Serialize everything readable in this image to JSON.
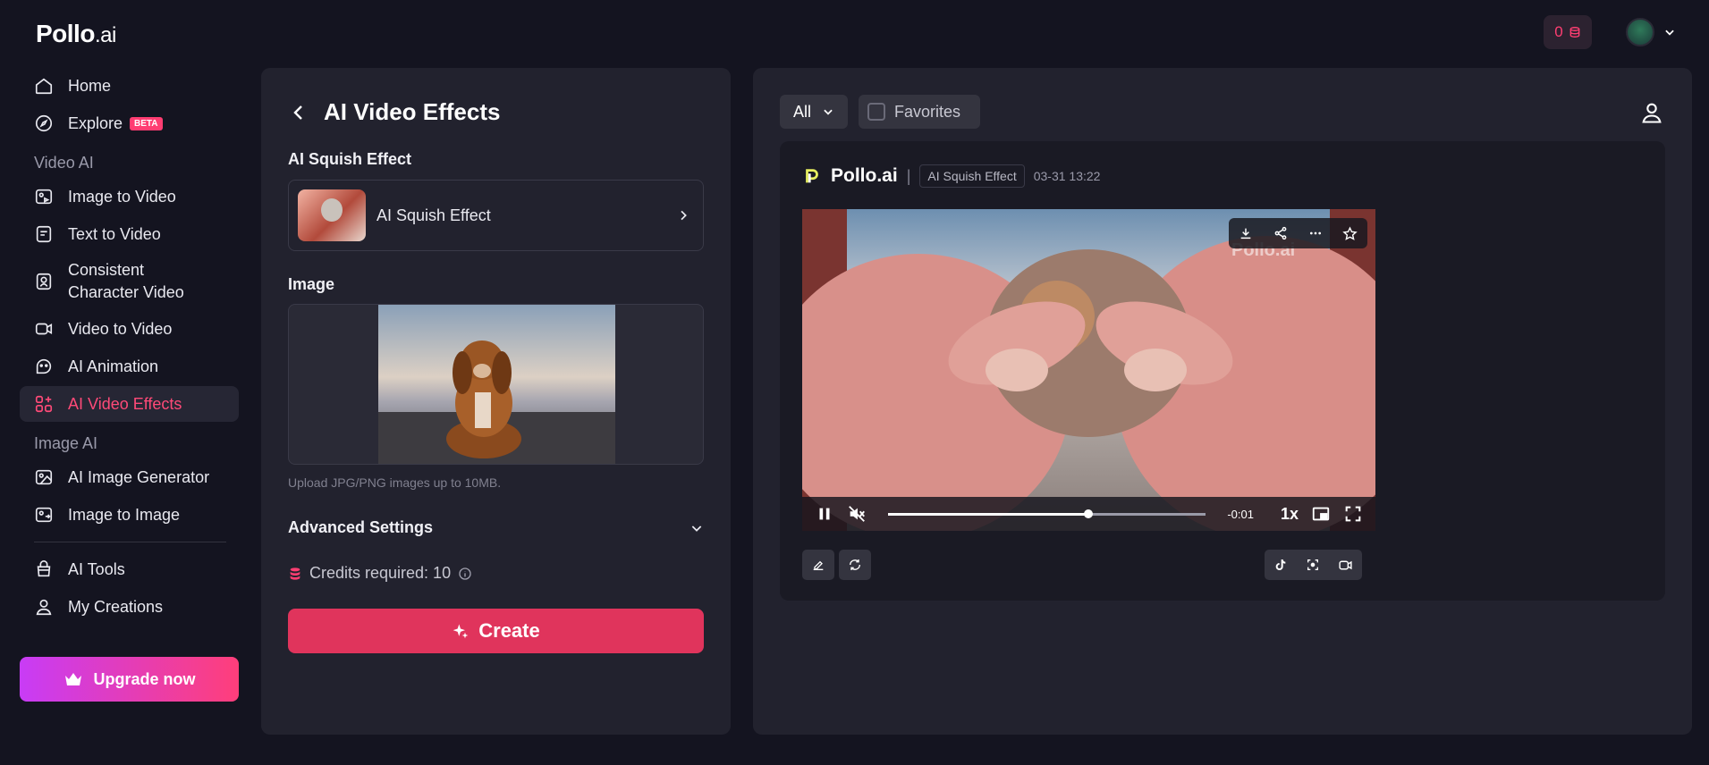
{
  "logo": {
    "main": "Pollo",
    "suffix": ".ai"
  },
  "sidebar": {
    "items": [
      {
        "label": "Home",
        "icon": "home-icon"
      },
      {
        "label": "Explore",
        "icon": "compass-icon",
        "badge": "BETA"
      }
    ],
    "section_video": "Video AI",
    "video_items": [
      {
        "label": "Image to Video",
        "icon": "image-video-icon"
      },
      {
        "label": "Text to Video",
        "icon": "text-video-icon"
      },
      {
        "label": "Consistent Character Video",
        "icon": "character-icon"
      },
      {
        "label": "Video to Video",
        "icon": "video-icon"
      },
      {
        "label": "AI Animation",
        "icon": "animation-icon"
      },
      {
        "label": "AI Video Effects",
        "icon": "effects-icon",
        "active": true
      }
    ],
    "section_image": "Image AI",
    "image_items": [
      {
        "label": "AI Image Generator",
        "icon": "image-gen-icon"
      },
      {
        "label": "Image to Image",
        "icon": "image-image-icon"
      }
    ],
    "bottom_items": [
      {
        "label": "AI Tools",
        "icon": "tools-icon"
      },
      {
        "label": "My Creations",
        "icon": "user-icon"
      }
    ],
    "upgrade_label": "Upgrade now"
  },
  "topbar": {
    "credits": "0"
  },
  "form": {
    "title": "AI Video Effects",
    "effect_label": "AI Squish Effect",
    "effect_selected": "AI Squish Effect",
    "image_label": "Image",
    "upload_hint": "Upload JPG/PNG images up to 10MB.",
    "advanced_label": "Advanced Settings",
    "credits_required": "Credits required: 10",
    "create_label": "Create"
  },
  "results": {
    "filter_value": "All",
    "favorites_label": "Favorites",
    "card": {
      "brand": "Pollo.ai",
      "tag": "AI Squish Effect",
      "timestamp": "03-31 13:22",
      "watermark": "Pollo.ai",
      "time_remaining": "-0:01",
      "speed": "1x",
      "progress": 0.63
    }
  },
  "colors": {
    "accent": "#ff3e72",
    "create": "#e0345c",
    "panel": "#22222e",
    "bg": "#141420"
  }
}
